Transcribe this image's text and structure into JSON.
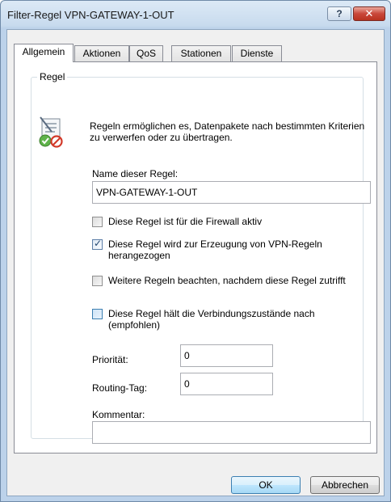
{
  "window": {
    "title": "Filter-Regel VPN-GATEWAY-1-OUT",
    "help_label": "?",
    "close_label": "✕"
  },
  "tabs": [
    {
      "label": "Allgemein",
      "active": true
    },
    {
      "label": "Aktionen",
      "active": false
    },
    {
      "label": "QoS",
      "active": false
    },
    {
      "label": "Stationen",
      "active": false
    },
    {
      "label": "Dienste",
      "active": false
    }
  ],
  "group": {
    "legend": "Regel",
    "description": "Regeln ermöglichen es, Datenpakete nach bestimmten Kriterien zu verwerfen oder zu übertragen.",
    "icon": "filter-rule-icon"
  },
  "form": {
    "name_label": "Name dieser Regel:",
    "name_value": "VPN-GATEWAY-1-OUT",
    "checkboxes": [
      {
        "label": "Diese Regel ist für die Firewall aktiv",
        "checked": false
      },
      {
        "label": "Diese Regel wird zur Erzeugung von VPN-Regeln herangezogen",
        "checked": true
      },
      {
        "label": "Weitere Regeln beachten, nachdem diese Regel zutrifft",
        "checked": false
      },
      {
        "label": "Diese Regel hält die Verbindungszustände nach (empfohlen)",
        "checked": false
      }
    ],
    "priority_label": "Priorität:",
    "priority_value": "0",
    "routing_tag_label": "Routing-Tag:",
    "routing_tag_value": "0",
    "comment_label": "Kommentar:",
    "comment_value": ""
  },
  "buttons": {
    "ok": "OK",
    "cancel": "Abbrechen"
  },
  "colors": {
    "titlebar": "#c8dbee",
    "close_button": "#c9473a",
    "default_button_border": "#3c7fb1"
  }
}
